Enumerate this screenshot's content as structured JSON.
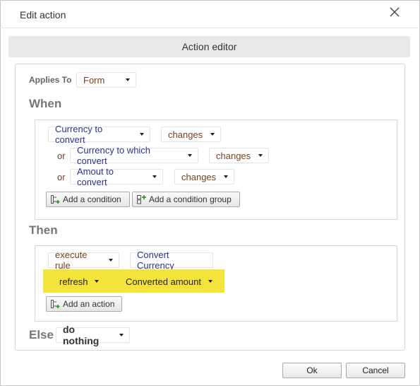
{
  "dialog": {
    "title": "Edit action",
    "header": "Action editor"
  },
  "applies_to": {
    "label": "Applies To",
    "value": "Form"
  },
  "when": {
    "heading": "When",
    "conditions": [
      {
        "connector": "",
        "field": "Currency to convert",
        "operator": "changes"
      },
      {
        "connector": "or",
        "field": "Currency to which convert",
        "operator": "changes"
      },
      {
        "connector": "or",
        "field": "Amout to convert",
        "operator": "changes"
      }
    ],
    "add_condition_label": "Add a condition",
    "add_group_label": "Add a condition group"
  },
  "then": {
    "heading": "Then",
    "actions": [
      {
        "verb": "execute rule",
        "target": "Convert Currency"
      },
      {
        "verb": "refresh",
        "target": "Converted amount"
      }
    ],
    "add_action_label": "Add an action"
  },
  "else": {
    "heading": "Else",
    "value": "do nothing"
  },
  "footer": {
    "ok_label": "Ok",
    "cancel_label": "Cancel"
  },
  "colors": {
    "highlight": "#f4e43a",
    "field_text": "#2e3192",
    "operator_text": "#7b3f1a"
  }
}
